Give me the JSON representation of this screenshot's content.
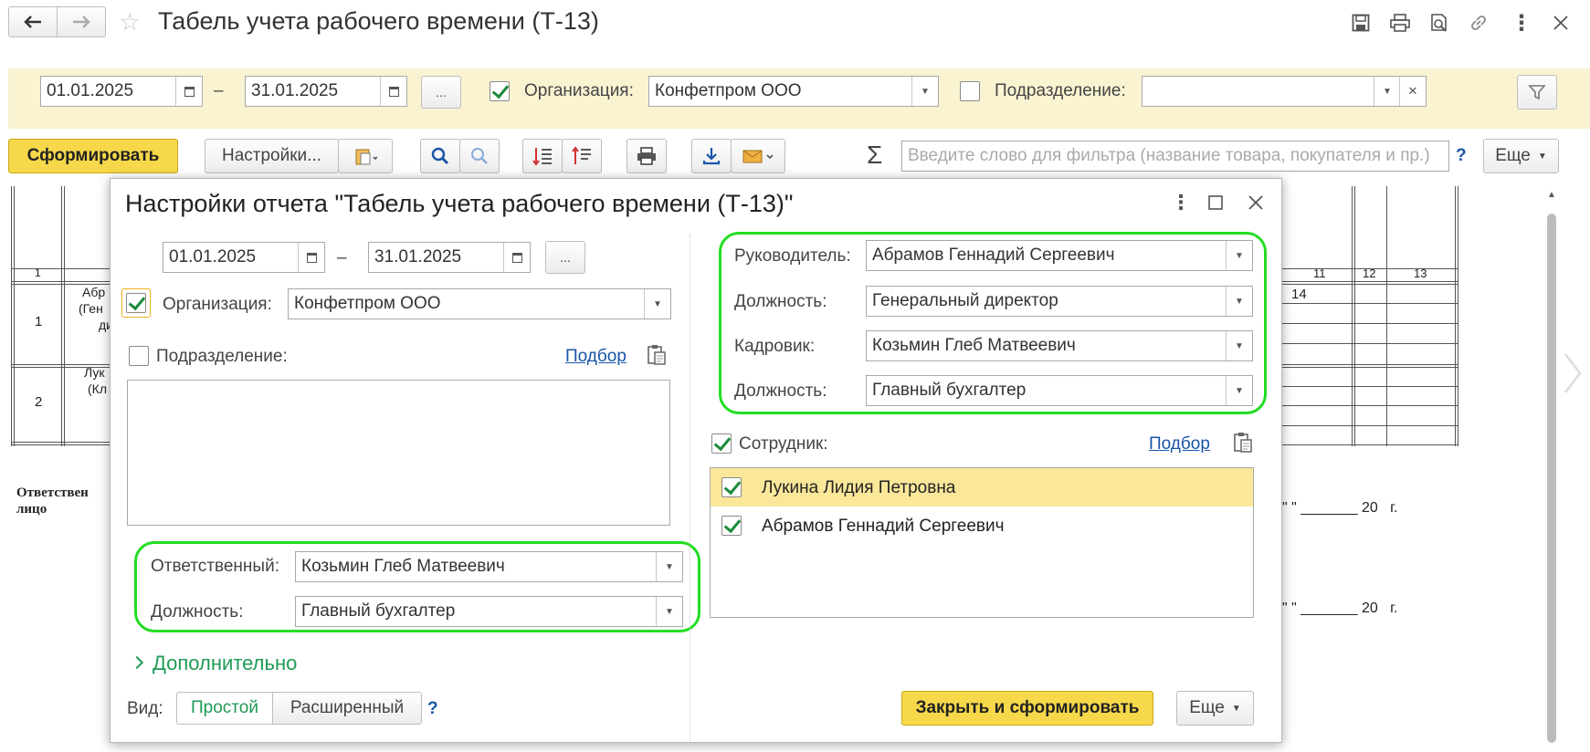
{
  "window": {
    "title": "Табель учета рабочего времени (Т-13)"
  },
  "filter_bar": {
    "date_from": "01.01.2025",
    "date_dash": "–",
    "date_to": "31.01.2025",
    "period_btn": "...",
    "org_label": "Организация:",
    "org_value": "Конфетпром ООО",
    "org_checked": true,
    "dept_label": "Подразделение:",
    "dept_value": "",
    "dept_checked": false
  },
  "toolbar": {
    "generate": "Сформировать",
    "settings": "Настройки...",
    "search_placeholder": "Введите слово для фильтра (название товара, покупателя и пр.)",
    "help": "?",
    "more": "Еще",
    "sigma": "Σ"
  },
  "report_bg": {
    "col_header_1": "1",
    "col_11": "11",
    "col_12": "12",
    "col_13": "13",
    "row1_num": "1",
    "row1_text1": "Абр",
    "row1_text2": "(Ген",
    "row1_text3": "ди",
    "row1_val": "14",
    "row2_num": "2",
    "row2_text1": "Лук",
    "row2_text2": "(Кл",
    "resp_label_1": "Ответствен",
    "resp_label_2": "лицо",
    "date_line_1": "\" \" _______ 20   г.",
    "date_line_2": "\" \" _______ 20   г."
  },
  "dialog": {
    "title": "Настройки отчета \"Табель учета рабочего времени (Т-13)\"",
    "date_from": "01.01.2025",
    "date_dash": "–",
    "date_to": "31.01.2025",
    "period_btn": "...",
    "org_label": "Организация:",
    "org_value": "Конфетпром ООО",
    "org_checked": true,
    "dept_label": "Подразделение:",
    "dept_checked": false,
    "pick_link": "Подбор",
    "responsible_label": "Ответственный:",
    "responsible_value": "Козьмин Глеб Матвеевич",
    "resp_position_label": "Должность:",
    "resp_position_value": "Главный бухгалтер",
    "more_section": "Дополнительно",
    "view_label": "Вид:",
    "view_simple": "Простой",
    "view_extended": "Расширенный",
    "help": "?",
    "head_label": "Руководитель:",
    "head_value": "Абрамов Геннадий Сергеевич",
    "head_position_label": "Должность:",
    "head_position_value": "Генеральный директор",
    "hr_label": "Кадровик:",
    "hr_value": "Козьмин Глеб Матвеевич",
    "hr_position_label": "Должность:",
    "hr_position_value": "Главный бухгалтер",
    "employee_label": "Сотрудник:",
    "employee_checked": true,
    "employee_pick_link": "Подбор",
    "employees": [
      {
        "name": "Лукина Лидия Петровна",
        "checked": true,
        "selected": true
      },
      {
        "name": "Абрамов Геннадий Сергеевич",
        "checked": true,
        "selected": false
      }
    ],
    "close_generate": "Закрыть и сформировать",
    "more": "Еще"
  },
  "colors": {
    "accent_yellow": "#f6d84a",
    "filter_bg": "#faf3d2",
    "highlight_green": "#22dd22",
    "selected_row": "#fbe79a",
    "link_blue": "#1a55a8",
    "more_green": "#1f9a55"
  }
}
